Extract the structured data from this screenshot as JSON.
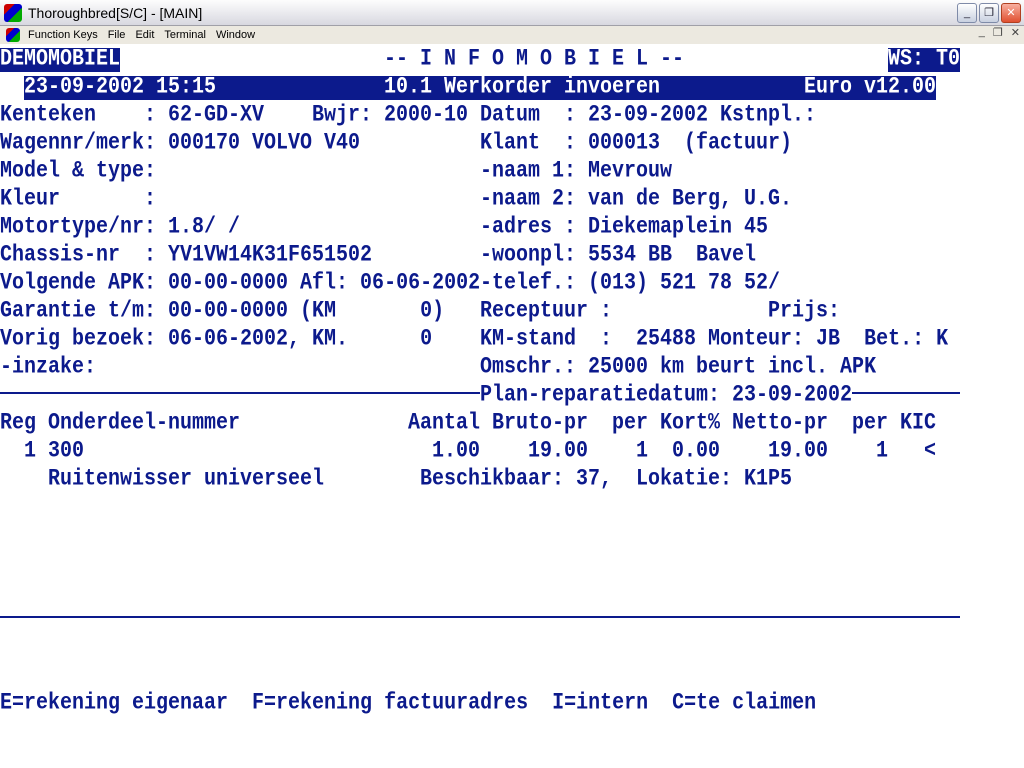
{
  "window": {
    "title": "Thoroughbred[S/C] - [MAIN]",
    "menu": [
      "Function Keys",
      "File",
      "Edit",
      "Terminal",
      "Window"
    ]
  },
  "colors": {
    "text": "#0c1a8c",
    "background": "#ffffff"
  },
  "header": {
    "company": "DEMOMOBIEL",
    "banner": "-- I N F O M O B I E L --",
    "ws": "WS: T0",
    "datetime": "23-09-2002 15:15",
    "screen_title": "10.1 Werkorder invoeren",
    "version": "Euro v12.00"
  },
  "vehicle": {
    "kenteken": "Kenteken    : 62-GD-XV",
    "bwjr": "Bwjr: 2000-10",
    "wagennr": "Wagennr/merk: 000170 VOLVO V40",
    "model": "Model & type:",
    "kleur": "Kleur       :",
    "motortype": "Motortype/nr: 1.8/ /",
    "chassis": "Chassis-nr  : YV1VW14K31F651502",
    "apk": "Volgende APK: 00-00-0000 Afl: 06-06-2002",
    "garantie": "Garantie t/m: 00-00-0000 (KM       0)",
    "vorig": "Vorig bezoek: 06-06-2002, KM.      0",
    "inzake": "-inzake:"
  },
  "customer": {
    "datum": "Datum  : 23-09-2002 Kstnpl.:",
    "klant": "Klant  : 000013  (factuur)",
    "naam1": "-naam 1: Mevrouw",
    "naam2": "-naam 2: van de Berg, U.G.",
    "adres": "-adres : Diekemaplein 45",
    "woonpl": "-woonpl: 5534 BB  Bavel",
    "telef": "-telef.: (013) 521 78 52/",
    "receptuur": "Receptuur :",
    "prijs": "Prijs:",
    "kmstand": "KM-stand  :  25488 Monteur: JB  Bet.: K",
    "omschr": "Omschr.: 25000 km beurt incl. APK"
  },
  "plan": "Plan-reparatiedatum: 23-09-2002",
  "table": {
    "headers": [
      "Reg",
      "Onderdeel-nummer",
      "Aantal",
      "Bruto-pr",
      "per",
      "Kort%",
      "Netto-pr",
      "per",
      "KIC"
    ],
    "rows": [
      {
        "reg": "1",
        "nummer": "300",
        "aantal": "1.00",
        "bruto": "19.00",
        "per1": "1",
        "kort": "0.00",
        "netto": "19.00",
        "per2": "1",
        "kic": "<",
        "omschrijving": "Ruitenwisser universeel",
        "info": "Beschikbaar: 37,  Lokatie: K1P5"
      }
    ]
  },
  "footer": "E=rekening eigenaar  F=rekening factuuradres  I=intern  C=te claimen"
}
